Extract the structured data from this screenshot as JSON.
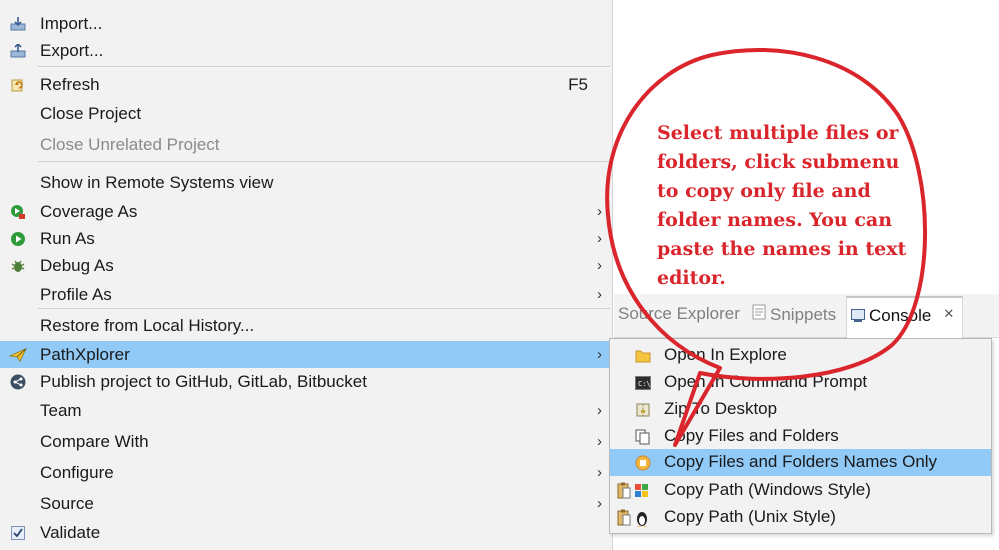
{
  "menu": {
    "items": [
      {
        "label": "Import...",
        "accel": "",
        "arrow": "",
        "icon": "import-icon"
      },
      {
        "label": "Export...",
        "accel": "",
        "arrow": "",
        "icon": "export-icon"
      },
      {
        "label": "Refresh",
        "accel": "F5",
        "arrow": "",
        "icon": "refresh-icon"
      },
      {
        "label": "Close Project",
        "accel": "",
        "arrow": "",
        "icon": ""
      },
      {
        "label": "Close Unrelated Project",
        "accel": "",
        "arrow": "",
        "icon": ""
      },
      {
        "label": "Show in Remote Systems view",
        "accel": "",
        "arrow": "",
        "icon": ""
      },
      {
        "label": "Coverage As",
        "accel": "",
        "arrow": "›",
        "icon": "coverage-icon"
      },
      {
        "label": "Run As",
        "accel": "",
        "arrow": "›",
        "icon": "run-icon"
      },
      {
        "label": "Debug As",
        "accel": "",
        "arrow": "›",
        "icon": "debug-bug-icon"
      },
      {
        "label": "Profile As",
        "accel": "",
        "arrow": "›",
        "icon": ""
      },
      {
        "label": "Restore from Local History...",
        "accel": "",
        "arrow": "",
        "icon": ""
      },
      {
        "label": "PathXplorer",
        "accel": "",
        "arrow": "›",
        "icon": "pathxplorer-icon"
      },
      {
        "label": "Publish project to GitHub, GitLab, Bitbucket",
        "accel": "",
        "arrow": "",
        "icon": "share-icon"
      },
      {
        "label": "Team",
        "accel": "",
        "arrow": "›",
        "icon": ""
      },
      {
        "label": "Compare With",
        "accel": "",
        "arrow": "›",
        "icon": ""
      },
      {
        "label": "Configure",
        "accel": "",
        "arrow": "›",
        "icon": ""
      },
      {
        "label": "Source",
        "accel": "",
        "arrow": "›",
        "icon": ""
      },
      {
        "label": "Validate",
        "accel": "",
        "arrow": "",
        "icon": "checkbox-icon"
      }
    ],
    "highlighted_item": "PathXplorer",
    "disabled_item": "Close Unrelated Project"
  },
  "view_tabs": [
    {
      "label": "Source Explorer",
      "icon": "",
      "active": false
    },
    {
      "label": "Snippets",
      "icon": "snippets-icon",
      "active": false
    },
    {
      "label": "Console",
      "icon": "console-icon",
      "active": true,
      "close": "✕"
    }
  ],
  "submenu": {
    "items": [
      {
        "label": "Open In Explore",
        "icon": "folder-icon"
      },
      {
        "label": "Open In Command Prompt",
        "icon": "command-prompt-icon"
      },
      {
        "label": "Zip To Desktop",
        "icon": "zip-icon"
      },
      {
        "label": "Copy Files and Folders",
        "icon": "copy-files-icon"
      },
      {
        "label": "Copy Files and Folders Names Only",
        "icon": "copy-names-icon"
      },
      {
        "label": "Copy Path (Windows Style)",
        "icon": "windows-path-icon"
      },
      {
        "label": "Copy Path (Unix Style)",
        "icon": "unix-path-icon"
      }
    ],
    "highlighted_item": "Copy Files and Folders Names Only"
  },
  "callout": {
    "lines": [
      "Select multiple files or",
      "folders, click submenu",
      "to copy only file and",
      "folder names. You can",
      "paste the names in text",
      "editor."
    ],
    "color": "#d9252b"
  },
  "colors": {
    "menu_bg": "#f2f2f2",
    "highlight": "#91c9f7",
    "callout_red": "#d9252b"
  }
}
